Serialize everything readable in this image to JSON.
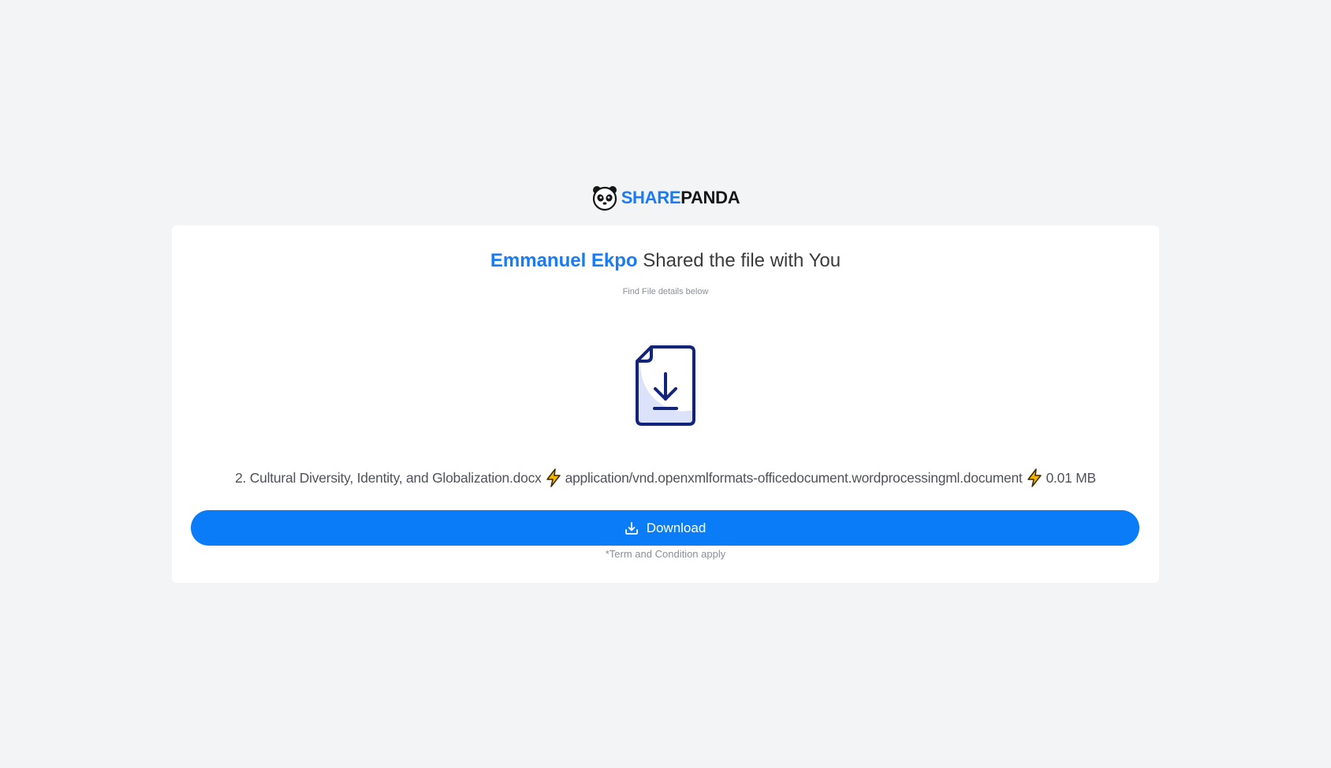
{
  "brand": {
    "share": "SHARE",
    "panda": "PANDA",
    "logo_icon": "panda-face-icon"
  },
  "share_card": {
    "sender_name": "Emmanuel Ekpo",
    "headline_rest": " Shared the file with You",
    "subtitle": "Find File details below",
    "file_icon": "file-download-icon",
    "file": {
      "name": "2. Cultural Diversity, Identity, and Globalization.docx",
      "mime_type": "application/vnd.openxmlformats-officedocument.wordprocessingml.document",
      "size": "0.01 MB",
      "separator_icon": "lightning-bolt-icon"
    },
    "download_label": "Download",
    "download_icon": "download-icon",
    "terms": "*Term and Condition apply"
  },
  "colors": {
    "accent": "#1a7cf5",
    "button": "#0a7cf7",
    "background": "#f3f4f6",
    "bolt": "#f5b400"
  }
}
